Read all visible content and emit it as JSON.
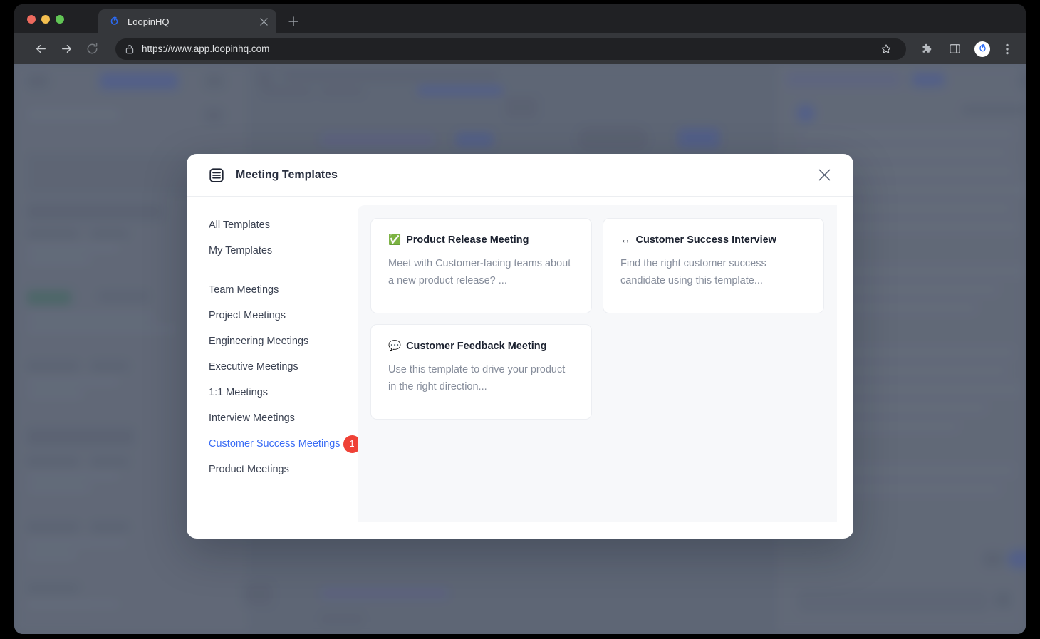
{
  "browser": {
    "tab": {
      "title": "LoopinHQ",
      "favicon": "loopinhq-logo-icon",
      "close": "✕"
    },
    "new_tab_label": "+",
    "nav": {
      "back": "back-icon",
      "forward": "forward-icon",
      "reload": "reload-icon"
    },
    "omnibox": {
      "lock": "lock-icon",
      "url": "https://www.app.loopinhq.com",
      "star": "star-icon"
    },
    "toolbar_icons": [
      "extensions-puzzle-icon",
      "side-panel-icon",
      "profile-avatar",
      "more-menu-icon"
    ],
    "accent_blue": "#3b6df5"
  },
  "modal": {
    "icon": "document-list-icon",
    "title": "Meeting Templates",
    "close_label": "✕",
    "sidebar": {
      "top_items": [
        {
          "label": "All Templates",
          "active": false
        },
        {
          "label": "My Templates",
          "active": false
        }
      ],
      "category_items": [
        {
          "label": "Team Meetings",
          "active": false,
          "badge": ""
        },
        {
          "label": "Project Meetings",
          "active": false,
          "badge": ""
        },
        {
          "label": "Engineering Meetings",
          "active": false,
          "badge": ""
        },
        {
          "label": "Executive Meetings",
          "active": false,
          "badge": ""
        },
        {
          "label": "1:1 Meetings",
          "active": false,
          "badge": ""
        },
        {
          "label": "Interview Meetings",
          "active": false,
          "badge": ""
        },
        {
          "label": "Customer Success Meetings",
          "active": true,
          "badge": "1"
        },
        {
          "label": "Product Meetings",
          "active": false,
          "badge": ""
        }
      ],
      "badge_color": "#ef4136"
    },
    "templates": [
      {
        "emoji": "✅",
        "emoji_name": "check-mark-button-icon",
        "title": "Product Release Meeting",
        "description": "Meet with Customer-facing teams about a new product release? ..."
      },
      {
        "emoji": "↔",
        "emoji_name": "left-right-arrow-icon",
        "title": "Customer Success Interview",
        "description": "Find the right customer success candidate using this template..."
      },
      {
        "emoji": "💬",
        "emoji_name": "speech-balloon-icon",
        "title": "Customer Feedback Meeting",
        "description": "Use this template to drive your product in the right direction..."
      }
    ]
  }
}
